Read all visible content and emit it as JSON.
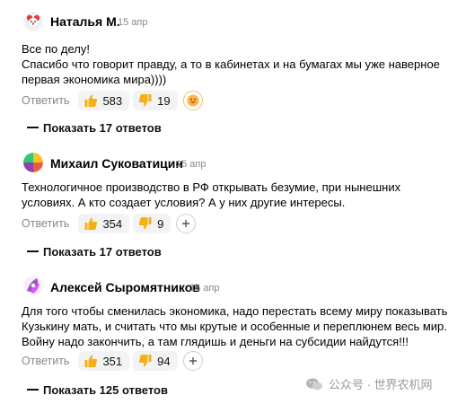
{
  "reply_label": "Ответить",
  "comments": [
    {
      "author": "Наталья М.",
      "date": "15 апр",
      "lines": [
        "Все по делу!",
        "Спасибо что говорит правду, а то в кабинетах и на бумагах мы уже наверное",
        "первая экономика мира))))"
      ],
      "likes": "583",
      "dislikes": "19",
      "show_replies": "Показать 17 ответов"
    },
    {
      "author": "Михаил Суковатицин",
      "date": "15 апр",
      "lines": [
        "Технологичное производство в РФ открывать безумие, при нынешних",
        "условиях. А кто создает условия? А у них другие интересы."
      ],
      "likes": "354",
      "dislikes": "9",
      "show_replies": "Показать 17 ответов"
    },
    {
      "author": "Алексей Сыромятников",
      "date": "15 апр",
      "lines": [
        "Для того чтобы сменилась экономика, надо перестать всему миру показывать",
        "Кузькину мать, и считать что мы крутые и особенные и переплюнем весь мир.",
        "Войну надо закончить, а там глядишь и деньги на субсидии найдутся!!!"
      ],
      "likes": "351",
      "dislikes": "94",
      "show_replies": "Показать 125 ответов"
    }
  ],
  "watermark": "公众号 · 世界农机网",
  "colors": {
    "like_thumb": "#f5b014",
    "pill_bg": "#f2f3f5"
  }
}
